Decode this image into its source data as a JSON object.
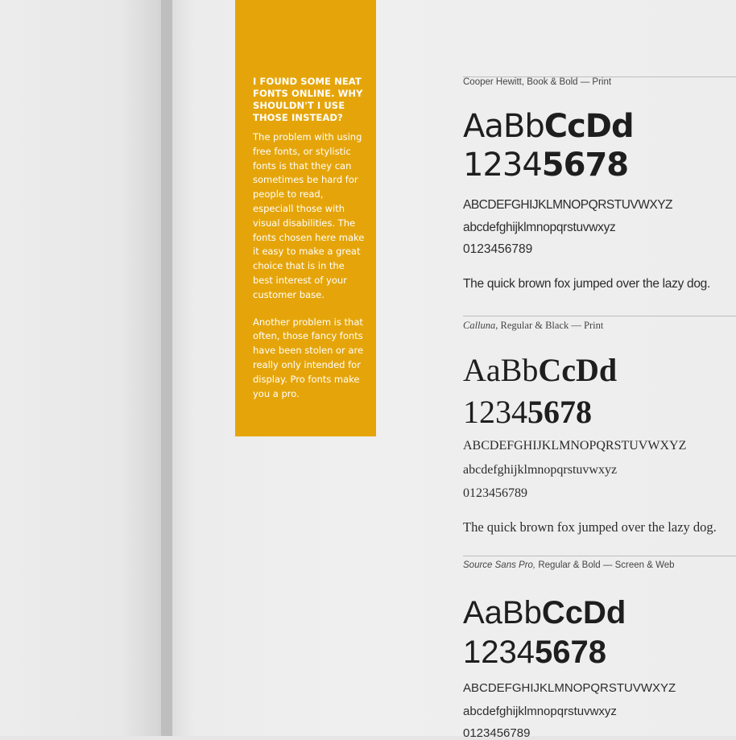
{
  "sidebar": {
    "heading": "I FOUND SOME NEAT FONTS ONLINE.  WHY SHOULDN'T I USE THOSE INSTEAD?",
    "paragraph1": "The problem with using free fonts, or  stylistic fonts is that they can sometimes be hard for people to read, especiall those with visual disabilities.  The fonts chosen here make it easy to make a great choice that is in the best interest of your customer base.",
    "paragraph2": "Another problem is that often, those fancy fonts have been stolen or are really only intended for display.  Pro fonts make you a pro."
  },
  "specimens": [
    {
      "caption": "Cooper Hewitt, Book & Bold — Print",
      "letters_regular": "AaBb",
      "letters_bold": "CcDd",
      "digits_regular": "1234",
      "digits_bold": "5678",
      "uppercase": "ABCDEFGHIJKLMNOPQRSTUVWXYZ",
      "lowercase": "abcdefghijklmnopqrstuvwxyz",
      "numerals": "0123456789",
      "sentence": "The quick brown fox jumped over the lazy dog."
    },
    {
      "caption_italic": "Calluna,",
      "caption_rest": " Regular & Black — Print",
      "letters_regular": "AaBb",
      "letters_bold": "CcDd",
      "digits_regular": "1234",
      "digits_bold": "5678",
      "uppercase": "ABCDEFGHIJKLMNOPQRSTUVWXYZ",
      "lowercase": "abcdefghijklmnopqrstuvwxyz",
      "numerals": "0123456789",
      "sentence": "The quick brown fox jumped over the lazy dog."
    },
    {
      "caption_italic": "Source Sans Pro,",
      "caption_rest": " Regular & Bold — Screen & Web",
      "letters_regular": "AaBb",
      "letters_bold": "CcDd",
      "digits_regular": "1234",
      "digits_bold": "5678",
      "uppercase": "ABCDEFGHIJKLMNOPQRSTUVWXYZ",
      "lowercase": "abcdefghijklmnopqrstuvwxyz",
      "numerals": "0123456789"
    }
  ]
}
